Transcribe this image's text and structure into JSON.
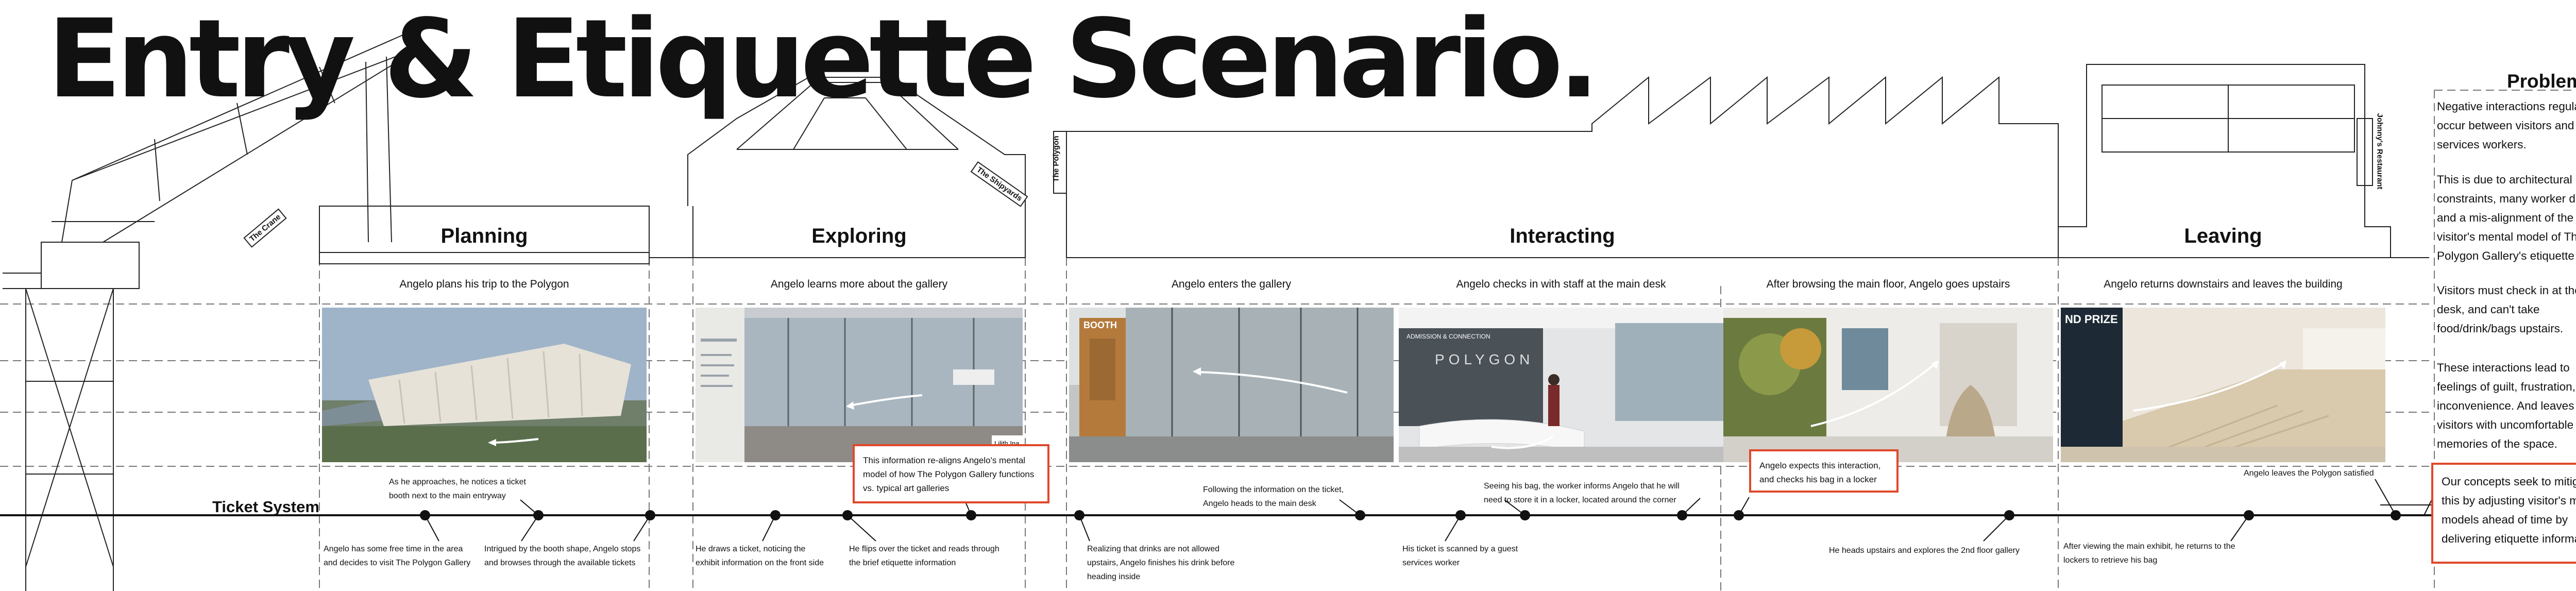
{
  "title": "Entry & Etiquette Scenario.",
  "signs": {
    "crane": "The Crane",
    "shipyards": "The Shipyards",
    "polygon": "The Polygon",
    "restaurant": "Johnny's Restaurant"
  },
  "ticket_system_label": "Ticket System",
  "phases": [
    {
      "title": "Planning"
    },
    {
      "title": "Exploring"
    },
    {
      "title": "Interacting"
    },
    {
      "title": "Leaving"
    }
  ],
  "captions": [
    "Angelo plans his trip to the Polygon",
    "Angelo learns more about the gallery",
    "Angelo enters the gallery",
    "Angelo checks in with staff at the main desk",
    "After browsing the main floor, Angelo goes upstairs",
    "Angelo returns downstairs and leaves the building"
  ],
  "photo_signage": {
    "booth": "BOOTH",
    "admission": "ADMISSION & CONNECTION",
    "polygon_vert": "POLYGON",
    "prize": "ND PRIZE",
    "lilith": "Lilith Ina"
  },
  "callouts": [
    "This information re-aligns Angelo's mental model of how The Polygon Gallery functions vs. typical art galleries",
    "Angelo expects this interaction, and checks his bag in a locker"
  ],
  "notes_above": [
    "As he approaches, he notices a ticket booth next to the main entryway",
    "Following the information on the ticket, Angelo heads to the main desk",
    "Seeing his bag, the worker informs Angelo that he will need to store it in a locker, located around the corner",
    "Angelo leaves the Polygon satisfied"
  ],
  "notes_below": [
    "Angelo has some free time in the area and decides to visit The Polygon Gallery",
    "Intrigued by the booth shape, Angelo stops and browses through the available tickets",
    "He draws a ticket, noticing the exhibit information on the front side",
    "He flips over the ticket and reads through the brief etiquette information",
    "Realizing that drinks are not allowed upstairs, Angelo finishes his drink before heading inside",
    "His ticket is scanned by a guest services worker",
    "He heads upstairs and explores the 2nd floor gallery",
    "After viewing the main exhibit, he returns to the lockers to retrieve his bag"
  ],
  "problem": {
    "title": "Problem",
    "p1": "Negative interactions regularly occur between visitors and guest services workers.",
    "p2": "This is due to architectural constraints, many worker duties, and a mis-alignment of the visitor's mental model of The Polygon Gallery's etiquette policy:",
    "p3": "Visitors must check in at the main desk, and can't take food/drink/bags upstairs.",
    "p4": "These interactions lead to feelings of guilt, frustration, and inconvenience. And leaves visitors with uncomfortable memories of the space.",
    "concept": "Our concepts seek to mitigate this by adjusting visitor's mental models ahead of time by delivering etiquette information."
  },
  "colors": {
    "accent": "#e0482b",
    "line": "#111111",
    "dashed": "#8a8a8a"
  }
}
